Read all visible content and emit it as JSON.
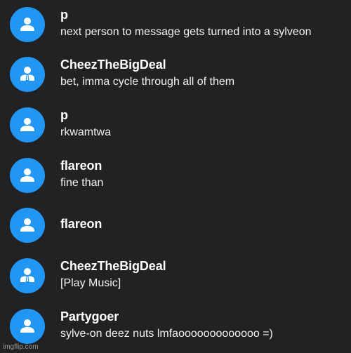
{
  "messages": [
    {
      "author": "p",
      "avatar_icon": "user-icon",
      "text": "next person to message gets turned into a sylveon"
    },
    {
      "author": "CheezTheBigDeal",
      "avatar_icon": "user-tie-icon",
      "text": "bet, imma cycle through all of them"
    },
    {
      "author": "p",
      "avatar_icon": "user-icon",
      "text": "rkwamtwa"
    },
    {
      "author": "flareon",
      "avatar_icon": "user-icon",
      "text": "fine than"
    },
    {
      "author": "flareon",
      "avatar_icon": "user-icon",
      "text": ""
    },
    {
      "author": "CheezTheBigDeal",
      "avatar_icon": "user-tie-icon",
      "text": "[Play Music]"
    },
    {
      "author": "Partygoer",
      "avatar_icon": "user-icon",
      "text": "sylve-on deez nuts lmfaooooooooooooo =)"
    }
  ],
  "watermark": "imgflip.com",
  "colors": {
    "background": "#222225",
    "avatar": "#2196f3",
    "text": "#ffffff"
  }
}
